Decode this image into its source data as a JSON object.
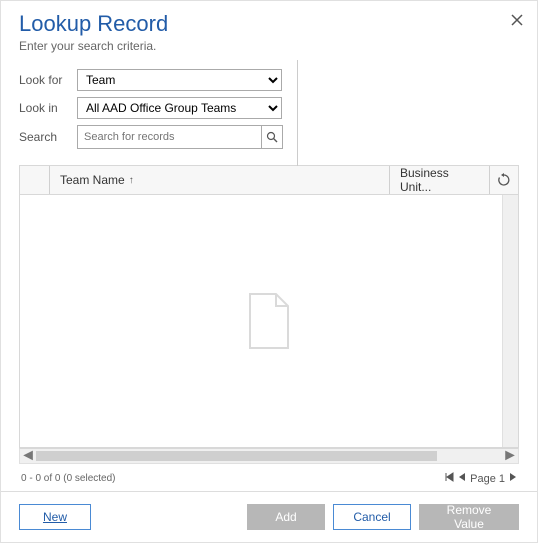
{
  "header": {
    "title": "Lookup Record",
    "subtitle": "Enter your search criteria."
  },
  "form": {
    "lookfor_label": "Look for",
    "lookfor_value": "Team",
    "lookin_label": "Look in",
    "lookin_value": "All AAD Office Group Teams",
    "search_label": "Search",
    "search_placeholder": "Search for records"
  },
  "grid": {
    "col1": "Team Name",
    "col1_sort": "↑",
    "col2": "Business Unit...",
    "rows": []
  },
  "status": {
    "range": "0 - 0 of 0 (0 selected)",
    "page_label": "Page 1"
  },
  "footer": {
    "new": "New",
    "add": "Add",
    "cancel": "Cancel",
    "remove": "Remove Value"
  }
}
